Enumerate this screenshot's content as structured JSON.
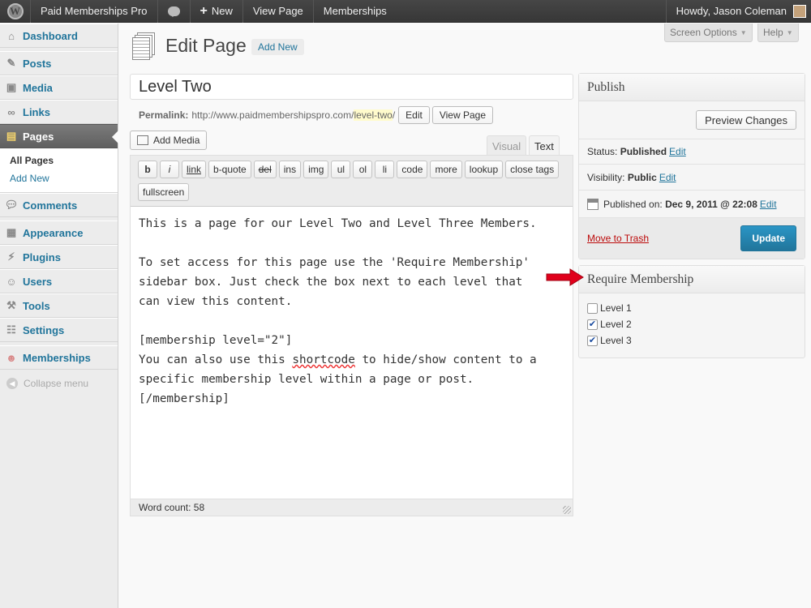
{
  "admin_bar": {
    "site_name": "Paid Memberships Pro",
    "new_label": "New",
    "view_page": "View Page",
    "memberships": "Memberships",
    "howdy": "Howdy, Jason Coleman"
  },
  "screen_meta": {
    "screen_options": "Screen Options",
    "help": "Help"
  },
  "sidebar": {
    "items": [
      {
        "label": "Dashboard",
        "icon": "house-icon"
      },
      {
        "label": "Posts",
        "icon": "pushpin-icon"
      },
      {
        "label": "Media",
        "icon": "media-icon"
      },
      {
        "label": "Links",
        "icon": "link-icon"
      },
      {
        "label": "Pages",
        "icon": "pages-icon"
      },
      {
        "label": "Comments",
        "icon": "comment-icon"
      },
      {
        "label": "Appearance",
        "icon": "appearance-icon"
      },
      {
        "label": "Plugins",
        "icon": "plugin-icon"
      },
      {
        "label": "Users",
        "icon": "users-icon"
      },
      {
        "label": "Tools",
        "icon": "tools-icon"
      },
      {
        "label": "Settings",
        "icon": "settings-icon"
      },
      {
        "label": "Memberships",
        "icon": "memberships-icon"
      }
    ],
    "submenu": [
      "All Pages",
      "Add New"
    ],
    "collapse": "Collapse menu"
  },
  "header": {
    "title": "Edit Page",
    "add_new": "Add New"
  },
  "post": {
    "title": "Level Two",
    "permalink_label": "Permalink:",
    "permalink_base": "http://www.paidmembershipspro.com/",
    "permalink_slug": "level-two",
    "permalink_end": "/",
    "edit_btn": "Edit",
    "view_btn": "View Page"
  },
  "editor": {
    "add_media": "Add Media",
    "tab_visual": "Visual",
    "tab_text": "Text",
    "quicktags": [
      "b",
      "i",
      "link",
      "b-quote",
      "del",
      "ins",
      "img",
      "ul",
      "ol",
      "li",
      "code",
      "more",
      "lookup",
      "close tags",
      "fullscreen"
    ],
    "content_lines": [
      "This is a page for our Level Two and Level Three Members.",
      "",
      "To set access for this page use the 'Require Membership'",
      "sidebar box. Just check the box next to each level that",
      "can view this content.",
      "",
      "[membership level=\"2\"]",
      "You can also use this ",
      "shortcode",
      " to hide/show content to a",
      "specific membership level within a page or post.",
      "[/membership]"
    ],
    "word_count": "Word count: 58"
  },
  "publish": {
    "title": "Publish",
    "preview": "Preview Changes",
    "status_label": "Status:",
    "status_value": "Published",
    "visibility_label": "Visibility:",
    "visibility_value": "Public",
    "published_label": "Published on:",
    "published_value": "Dec 9, 2011 @ 22:08",
    "edit": "Edit",
    "trash": "Move to Trash",
    "update": "Update"
  },
  "require_membership": {
    "title": "Require Membership",
    "levels": [
      {
        "label": "Level 1",
        "checked": false
      },
      {
        "label": "Level 2",
        "checked": true
      },
      {
        "label": "Level 3",
        "checked": true
      }
    ]
  },
  "colors": {
    "link": "#21759b",
    "update_button": "#21759b",
    "trash": "#bc0b0b",
    "annotation_arrow": "#e0001b"
  }
}
